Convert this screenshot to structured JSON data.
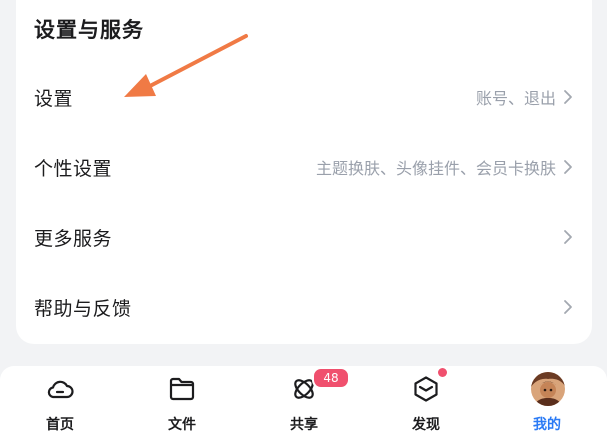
{
  "section": {
    "title": "设置与服务"
  },
  "rows": [
    {
      "label": "设置",
      "desc": "账号、退出"
    },
    {
      "label": "个性设置",
      "desc": "主题换肤、头像挂件、会员卡换肤"
    },
    {
      "label": "更多服务",
      "desc": ""
    },
    {
      "label": "帮助与反馈",
      "desc": ""
    }
  ],
  "tabbar": {
    "tabs": [
      {
        "label": "首页",
        "icon": "cloud-icon"
      },
      {
        "label": "文件",
        "icon": "folder-icon"
      },
      {
        "label": "共享",
        "icon": "orbit-icon",
        "badge": "48"
      },
      {
        "label": "发现",
        "icon": "cube-icon"
      },
      {
        "label": "我的",
        "icon": "avatar",
        "active": true
      }
    ]
  },
  "colors": {
    "accent": "#2a7af5",
    "annotation_arrow": "#f07a45",
    "badge": "#f0506e",
    "secondary_text": "#9aa0ab"
  }
}
